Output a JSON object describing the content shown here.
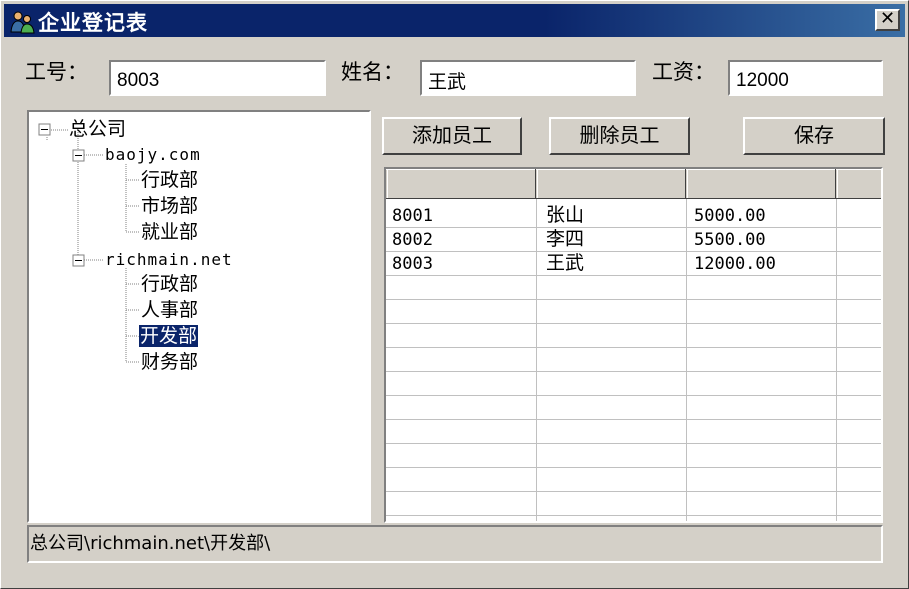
{
  "window": {
    "title": "企业登记表",
    "close_label": "✕"
  },
  "form": {
    "id_label": "工号：",
    "id_value": "8003",
    "name_label": "姓名：",
    "name_value": "王武",
    "salary_label": "工资：",
    "salary_value": "12000"
  },
  "tree": {
    "root": "总公司",
    "nodes": [
      {
        "label": "baojy.com",
        "children": [
          "行政部",
          "市场部",
          "就业部"
        ]
      },
      {
        "label": "richmain.net",
        "children": [
          "行政部",
          "人事部",
          "开发部",
          "财务部"
        ]
      }
    ],
    "selected": "开发部"
  },
  "buttons": {
    "add": "添加员工",
    "delete": "删除员工",
    "save": "保存"
  },
  "table": {
    "headers": [
      "",
      "",
      "",
      ""
    ],
    "rows": [
      [
        "8001",
        "张山",
        "5000.00"
      ],
      [
        "8002",
        "李四",
        "5500.00"
      ],
      [
        "8003",
        "王武",
        "12000.00"
      ]
    ]
  },
  "status": {
    "path": "总公司\\richmain.net\\开发部\\"
  }
}
